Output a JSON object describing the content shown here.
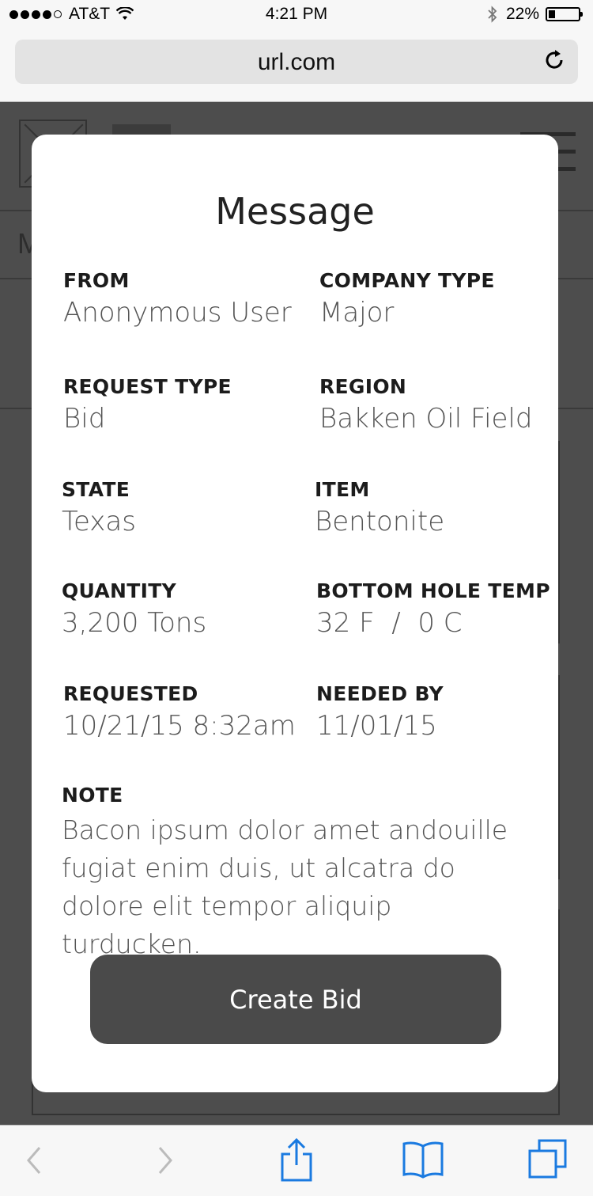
{
  "status_bar": {
    "carrier": "AT&T",
    "time": "4:21 PM",
    "battery": "22%"
  },
  "browser": {
    "url": "url.com"
  },
  "background_page": {
    "row_label_partial": "M"
  },
  "modal": {
    "title": "Message",
    "fields": {
      "from": {
        "label": "FROM",
        "value": "Anonymous User"
      },
      "company_type": {
        "label": "COMPANY TYPE",
        "value": "Major"
      },
      "request_type": {
        "label": "REQUEST TYPE",
        "value": "Bid"
      },
      "region": {
        "label": "REGION",
        "value": "Bakken Oil Field"
      },
      "state": {
        "label": "STATE",
        "value": "Texas"
      },
      "item": {
        "label": "ITEM",
        "value": "Bentonite"
      },
      "quantity": {
        "label": "QUANTITY",
        "value": "3,200 Tons"
      },
      "bottom_hole_temp": {
        "label": "BOTTOM HOLE TEMP",
        "value": "32 F  /  0 C"
      },
      "requested": {
        "label": "REQUESTED",
        "value": "10/21/15 8:32am"
      },
      "needed_by": {
        "label": "NEEDED BY",
        "value": "11/01/15"
      },
      "note": {
        "label": "NOTE",
        "value": "Bacon ipsum dolor amet andouille fugiat enim duis, ut alcatra do dolore elit tempor aliquip turducken."
      }
    },
    "cta_label": "Create Bid"
  },
  "colors": {
    "accent": "#1a7ae0",
    "overlay": "#4d4d4d",
    "button": "#4a4a4a"
  },
  "icons": [
    "wifi-icon",
    "bluetooth-icon",
    "battery-icon",
    "reload-icon",
    "back-icon",
    "forward-icon",
    "share-icon",
    "bookmarks-icon",
    "tabs-icon"
  ]
}
